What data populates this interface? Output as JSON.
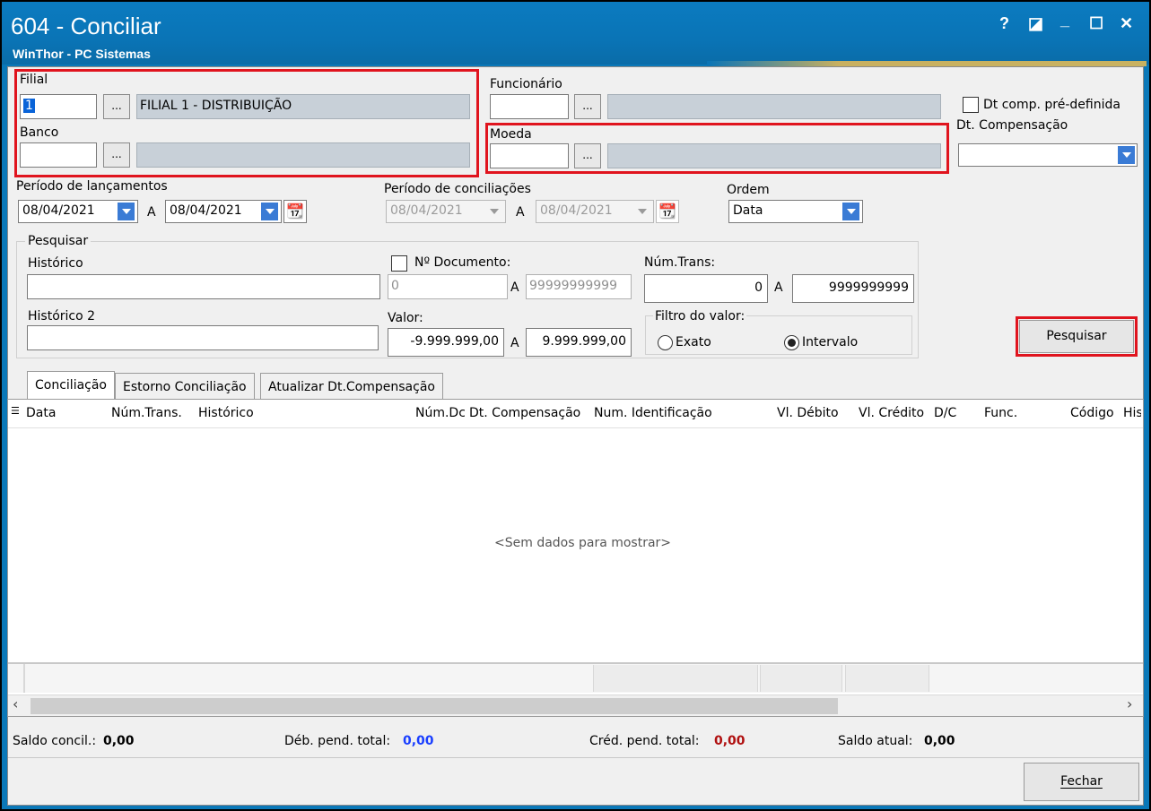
{
  "window": {
    "title": "604 - Conciliar",
    "subtitle": "WinThor - PC Sistemas",
    "controls": [
      "?",
      "◪",
      "_",
      "☐",
      "✕"
    ]
  },
  "filial": {
    "label": "Filial",
    "code": "1",
    "name": "FILIAL 1 - DISTRIBUIÇÃO"
  },
  "banco": {
    "label": "Banco",
    "code": "",
    "name": ""
  },
  "funcionario": {
    "label": "Funcionário",
    "code": "",
    "name": ""
  },
  "moeda": {
    "label": "Moeda",
    "code": "",
    "name": ""
  },
  "dtcomp": {
    "checkbox_label": "Dt comp. pré-definida",
    "label": "Dt. Compensação",
    "value": ""
  },
  "lookup_button": "...",
  "periodo_lanc": {
    "label": "Período de lançamentos",
    "from": "08/04/2021",
    "sep": "A",
    "to": "08/04/2021"
  },
  "periodo_conc": {
    "label": "Período de conciliações",
    "from": "08/04/2021",
    "sep": "A",
    "to": "08/04/2021"
  },
  "ordem": {
    "label": "Ordem",
    "value": "Data"
  },
  "pesquisar_group": {
    "label": "Pesquisar",
    "historico_label": "Histórico",
    "historico2_label": "Histórico 2",
    "ndoc_label": "Nº Documento:",
    "ndoc_from": "0",
    "ndoc_sep": "A",
    "ndoc_to": "99999999999",
    "numtrans_label": "Núm.Trans:",
    "numtrans_from": "0",
    "numtrans_sep": "A",
    "numtrans_to": "9999999999",
    "valor_label": "Valor:",
    "valor_from": "-9.999.999,00",
    "valor_sep": "A",
    "valor_to": "9.999.999,00",
    "filtro_label": "Filtro do valor:",
    "exato": "Exato",
    "intervalo": "Intervalo"
  },
  "pesquisar_button": "Pesquisar",
  "tabs": [
    "Conciliação",
    "Estorno Conciliação",
    "Atualizar Dt.Compensação"
  ],
  "grid": {
    "columns": [
      "Data",
      "Núm.Trans.",
      "Histórico",
      "Núm.Dc",
      "Dt. Compensação",
      "Num. Identificação",
      "Vl. Débito",
      "Vl. Crédito",
      "D/C",
      "Func.",
      "Código",
      "His"
    ],
    "empty_text": "<Sem dados para mostrar>"
  },
  "totals": {
    "saldo_concil_label": "Saldo concil.:",
    "saldo_concil_value": "0,00",
    "deb_label": "Déb. pend. total:",
    "deb_value": "0,00",
    "cred_label": "Créd. pend. total:",
    "cred_value": "0,00",
    "saldo_atual_label": "Saldo atual:",
    "saldo_atual_value": "0,00"
  },
  "fechar_button": "Fechar",
  "colors": {
    "titlebar": "#0a78b8",
    "highlight": "#e0141e",
    "debit": "#1a3fff",
    "credit": "#b01010"
  }
}
